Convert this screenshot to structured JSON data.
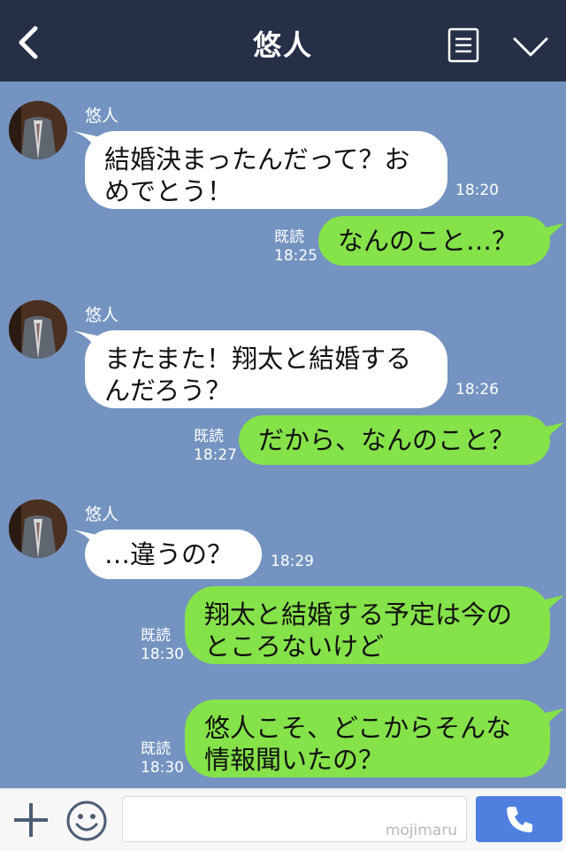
{
  "header": {
    "title": "悠人"
  },
  "messages": [
    {
      "sender": "悠人",
      "text": "結婚決まったんだって？おめでとう！",
      "time": "18:20"
    },
    {
      "read": "既読",
      "time": "18:25",
      "text": "なんのこと…？"
    },
    {
      "sender": "悠人",
      "text": "またまた！翔太と結婚するんだろう？",
      "time": "18:26"
    },
    {
      "read": "既読",
      "time": "18:27",
      "text": "だから、なんのこと？"
    },
    {
      "sender": "悠人",
      "text": "…違うの？",
      "time": "18:29"
    },
    {
      "read": "既読",
      "time": "18:30",
      "text": "翔太と結婚する予定は今のところないけど"
    },
    {
      "read": "既読",
      "time": "18:30",
      "text": "悠人こそ、どこからそんな情報聞いたの？"
    }
  ],
  "footer": {
    "input_value": "",
    "watermark": "mojimaru"
  },
  "colors": {
    "header_bg": "#253047",
    "chat_bg": "#7493c0",
    "bubble_out": "#85e249",
    "bubble_in": "#ffffff",
    "call_button": "#4f80e0"
  }
}
